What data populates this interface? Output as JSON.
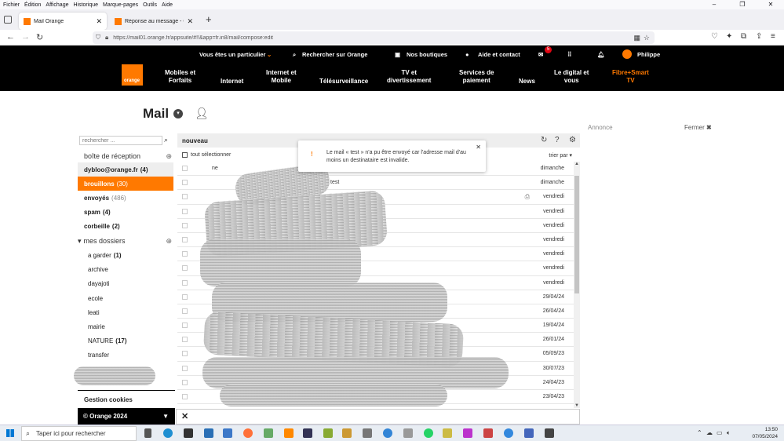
{
  "browser": {
    "menu": [
      "Fichier",
      "Édition",
      "Affichage",
      "Historique",
      "Marque-pages",
      "Outils",
      "Aide"
    ],
    "tabs": [
      {
        "label": "Mail Orange",
        "active": true
      },
      {
        "label": "Réponse au message - Comm",
        "active": false
      }
    ],
    "url": "https://mail01.orange.fr/appsuite/#!!&app=fr.in8/mail/compose:edit"
  },
  "orange_header": {
    "top": {
      "particulier": "Vous êtes un particulier",
      "search": "Rechercher sur Orange",
      "boutiques": "Nos boutiques",
      "aide": "Aide et contact",
      "mail_badge": "5",
      "user": "Philippe"
    },
    "logo_text": "orange",
    "nav": [
      "Mobiles et\nForfaits",
      "Internet",
      "Internet et\nMobile",
      "Télésurveillance",
      "TV et\ndivertissement",
      "Services de\npaiement",
      "News",
      "Le digital et\nvous",
      "Fibre+Smart\nTV"
    ]
  },
  "mail": {
    "title": "Mail",
    "annonce": "Annonce",
    "fermer": "Fermer",
    "search_placeholder": "rechercher ...",
    "toolbar": {
      "new": "nouveau"
    },
    "select_all": "tout sélectionner",
    "sort": "trier par",
    "folders": {
      "inbox_header": "boîte de réception",
      "account": {
        "name": "dybloo@orange.fr",
        "count": "(4)"
      },
      "brouillons": {
        "name": "brouillons",
        "count": "(30)"
      },
      "envoyes": {
        "name": "envoyés",
        "count": "(486)"
      },
      "spam": {
        "name": "spam",
        "count": "(4)"
      },
      "corbeille": {
        "name": "corbeille",
        "count": "(2)"
      },
      "mes_dossiers": "mes dossiers",
      "custom": [
        {
          "name": "a garder",
          "count": "(1)"
        },
        {
          "name": "archive",
          "count": ""
        },
        {
          "name": "dayajoti",
          "count": ""
        },
        {
          "name": "ecole",
          "count": ""
        },
        {
          "name": "leati",
          "count": ""
        },
        {
          "name": "mairie",
          "count": ""
        },
        {
          "name": "NATURE",
          "count": "(17)"
        },
        {
          "name": "transfer",
          "count": ""
        }
      ]
    },
    "gestion_cookies": "Gestion cookies",
    "copyright": "© Orange 2024",
    "messages": [
      {
        "from": "ne",
        "subject": "",
        "date": "dimanche"
      },
      {
        "from": "",
        "subject": "test",
        "date": "dimanche"
      },
      {
        "from": "",
        "subject": "",
        "date": "vendredi"
      },
      {
        "from": "",
        "subject": "",
        "date": "vendredi"
      },
      {
        "from": "",
        "subject": "",
        "date": "vendredi"
      },
      {
        "from": "",
        "subject": "",
        "date": "vendredi"
      },
      {
        "from": "",
        "subject": "",
        "date": "vendredi"
      },
      {
        "from": "",
        "subject": "",
        "date": "vendredi"
      },
      {
        "from": "",
        "subject": "",
        "date": "vendredi"
      },
      {
        "from": "",
        "subject": "",
        "date": "29/04/24"
      },
      {
        "from": "",
        "subject": "",
        "date": "26/04/24"
      },
      {
        "from": "",
        "subject": "",
        "date": "19/04/24"
      },
      {
        "from": "",
        "subject": "",
        "date": "26/01/24"
      },
      {
        "from": "",
        "subject": "",
        "date": "05/09/23"
      },
      {
        "from": "",
        "subject": "",
        "date": "30/07/23"
      },
      {
        "from": "",
        "subject": "",
        "date": "24/04/23"
      },
      {
        "from": "",
        "subject": "",
        "date": "23/04/23"
      }
    ],
    "toast": "Le mail « test » n'a pu être envoyé car l'adresse mail d'au moins un destinataire est invalide."
  },
  "taskbar": {
    "search": "Taper ici pour rechercher",
    "time": "13:50",
    "date": "07/05/2024"
  },
  "colors": {
    "accent": "#ff7900",
    "header_bg": "#000000"
  }
}
